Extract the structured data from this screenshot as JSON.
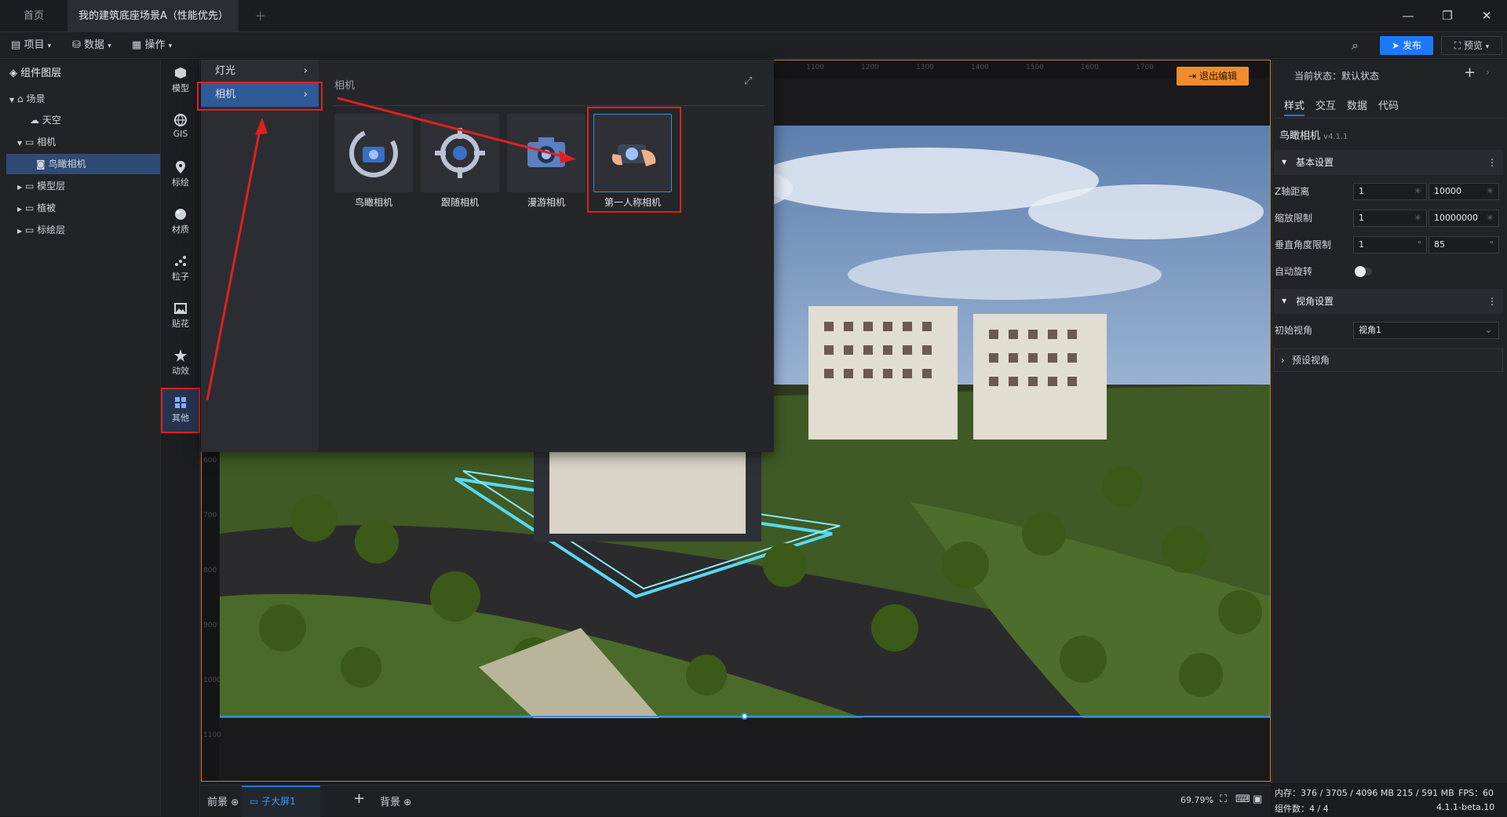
{
  "tabs": {
    "home": "首页",
    "project": "我的建筑底座场景A（性能优先）",
    "add": "+"
  },
  "window": {
    "minimize": "—",
    "restore": "❐",
    "close": "✕"
  },
  "toolbar": {
    "project": "项目",
    "data": "数据",
    "operate": "操作",
    "publish": "发布",
    "preview": "预览"
  },
  "layers": {
    "title": "组件图层",
    "items": [
      {
        "label": "场景"
      },
      {
        "label": "天空"
      },
      {
        "label": "相机"
      },
      {
        "label": "鸟瞰相机"
      },
      {
        "label": "模型层"
      },
      {
        "label": "植被"
      },
      {
        "label": "标绘层"
      }
    ]
  },
  "rail": {
    "items": [
      {
        "label": "模型"
      },
      {
        "label": "GIS"
      },
      {
        "label": "标绘"
      },
      {
        "label": "材质"
      },
      {
        "label": "粒子"
      },
      {
        "label": "贴花"
      },
      {
        "label": "动效"
      },
      {
        "label": "其他"
      }
    ]
  },
  "popup": {
    "categories": [
      {
        "label": "灯光"
      },
      {
        "label": "相机"
      }
    ],
    "section_title": "相机",
    "cards": [
      {
        "label": "鸟瞰相机"
      },
      {
        "label": "跟随相机"
      },
      {
        "label": "漫游相机"
      },
      {
        "label": "第一人称相机"
      }
    ]
  },
  "canvas": {
    "exit_edit": "退出编辑",
    "ruler_top": [
      "1100",
      "1200",
      "1300",
      "1400",
      "1500",
      "1600",
      "1700"
    ],
    "ruler_left": [
      "600",
      "700",
      "800",
      "900",
      "1000",
      "1100"
    ]
  },
  "bottom": {
    "foreground": "前景",
    "subscreen": "子大屏1",
    "background": "背景",
    "zoom": "69.79%"
  },
  "right": {
    "state_label": "当前状态：默认状态",
    "tabs": [
      "样式",
      "交互",
      "数据",
      "代码"
    ],
    "component_name": "鸟瞰相机",
    "component_version": "v4.1.1",
    "basic_settings": "基本设置",
    "fields": {
      "z_distance": {
        "label": "Z轴距离",
        "min": "1",
        "max": "10000"
      },
      "zoom_limit": {
        "label": "缩放限制",
        "min": "1",
        "max": "10000000"
      },
      "vertical_angle": {
        "label": "垂直角度限制",
        "min": "1",
        "max": "85",
        "unit": "°"
      },
      "auto_rotate": {
        "label": "自动旋转"
      }
    },
    "view_settings": "视角设置",
    "initial_view": {
      "label": "初始视角",
      "value": "视角1"
    },
    "preset_view": "预设视角"
  },
  "status": {
    "memory": "内存：376 / 3705 / 4096 MB  215 / 591 MB",
    "fps": "FPS：60",
    "components": "组件数：4 / 4",
    "version": "4.1.1-beta.10"
  },
  "colors": {
    "accent": "#1a79ff",
    "selection": "#2f5a98",
    "highlight_red": "#e02020",
    "exit_btn": "#f08c2a"
  }
}
